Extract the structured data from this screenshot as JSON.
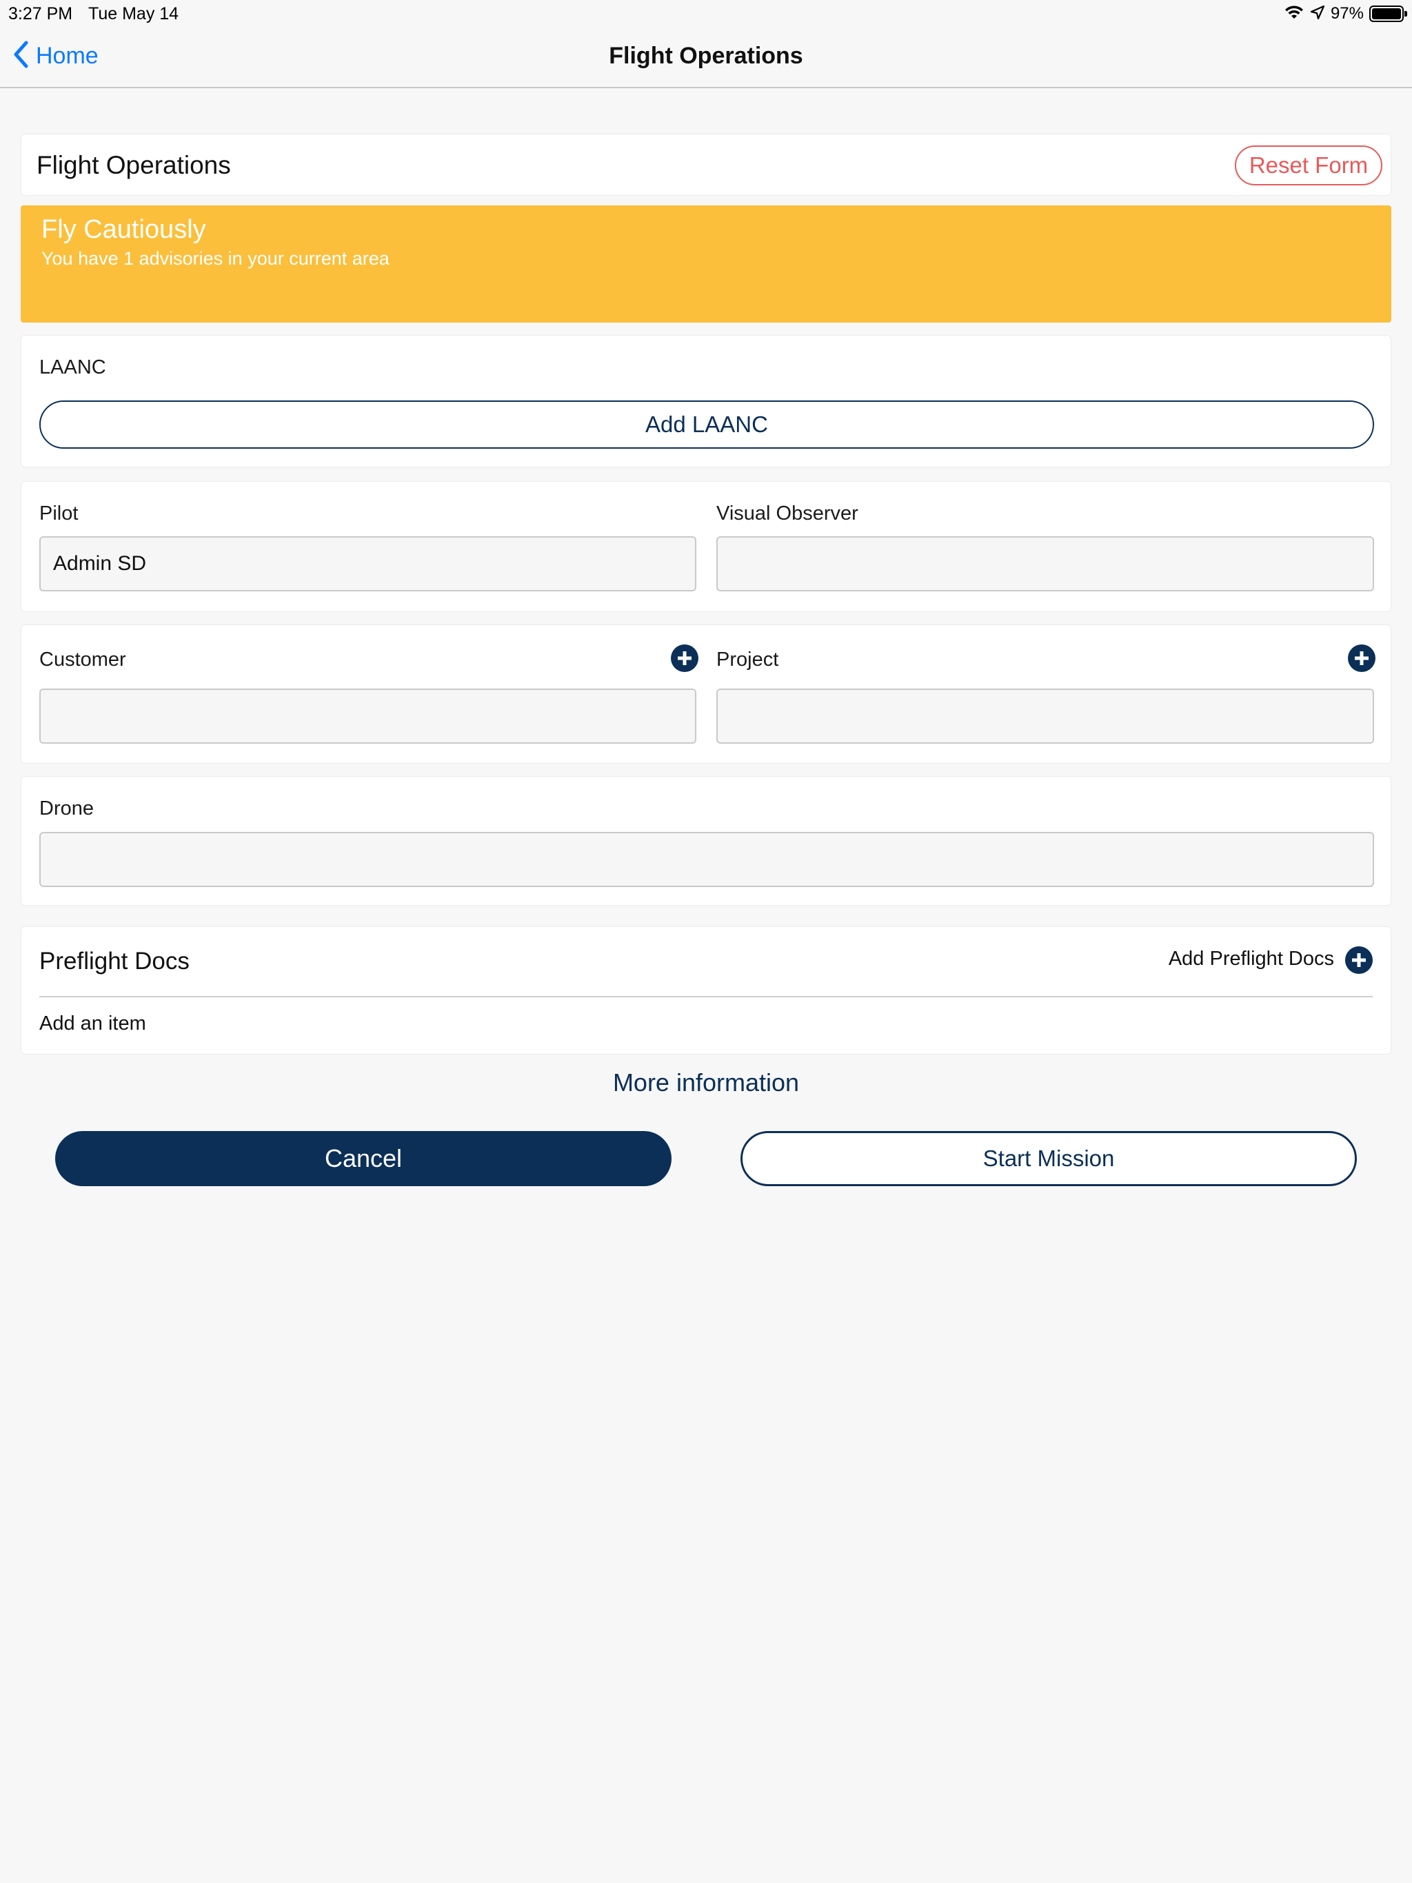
{
  "status_bar": {
    "time": "3:27 PM",
    "date": "Tue May 14",
    "battery_percent": "97%"
  },
  "nav": {
    "back_label": "Home",
    "title": "Flight Operations"
  },
  "header": {
    "title": "Flight Operations",
    "reset_label": "Reset Form"
  },
  "advisory": {
    "title": "Fly Cautiously",
    "message": "You have 1 advisories in your current area",
    "color": "#fbbf3c"
  },
  "laanc": {
    "label": "LAANC",
    "button_label": "Add LAANC"
  },
  "pilot": {
    "label": "Pilot",
    "value": "Admin SD"
  },
  "visual_observer": {
    "label": "Visual Observer",
    "value": ""
  },
  "customer": {
    "label": "Customer",
    "value": ""
  },
  "project": {
    "label": "Project",
    "value": ""
  },
  "drone": {
    "label": "Drone",
    "value": ""
  },
  "preflight_docs": {
    "title": "Preflight Docs",
    "add_label": "Add Preflight Docs",
    "item_placeholder": "Add an item"
  },
  "more_info_label": "More information",
  "actions": {
    "cancel_label": "Cancel",
    "start_label": "Start Mission"
  },
  "colors": {
    "primary": "#0b2f57",
    "link": "#0a7aff",
    "danger": "#e75a5a"
  },
  "icons": [
    "wifi-icon",
    "location-arrow-icon",
    "battery-icon",
    "chevron-left-icon",
    "plus-circle-icon"
  ]
}
